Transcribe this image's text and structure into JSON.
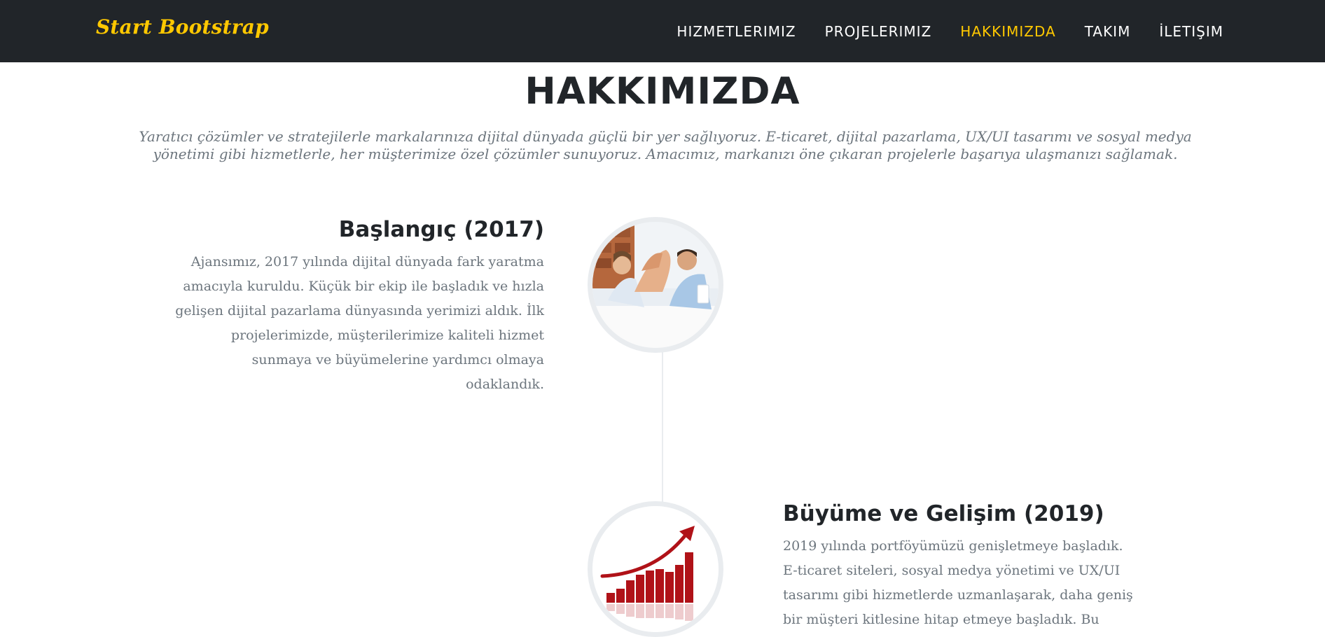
{
  "navbar": {
    "brand": "Start Bootstrap",
    "links": [
      {
        "label": "HIZMETLERIMIZ",
        "active": false
      },
      {
        "label": "PROJELERIMIZ",
        "active": false
      },
      {
        "label": "HAKKIMIZDA",
        "active": true
      },
      {
        "label": "TAKIM",
        "active": false
      },
      {
        "label": "İLETIŞIM",
        "active": false
      }
    ]
  },
  "section": {
    "heading": "HAKKIMIZDA",
    "subheading": "Yaratıcı çözümler ve stratejilerle markalarınıza dijital dünyada güçlü bir yer sağlıyoruz. E-ticaret, dijital pazarlama, UX/UI tasarımı ve sosyal medya yönetimi gibi hizmetlerle, her müşterimize özel çözümler sunuyoruz. Amacımız, markanızı öne çıkaran projelerle başarıya ulaşmanızı sağlamak."
  },
  "timeline": [
    {
      "title": "Başlangıç (2017)",
      "body": "Ajansımız, 2017 yılında dijital dünyada fark yaratma amacıyla kuruldu. Küçük bir ekip ile başladık ve hızla gelişen dijital pazarlama dünyasında yerimizi aldık. İlk projelerimizde, müşterilerimize kaliteli hizmet sunmaya ve büyümelerine yardımcı olmaya odaklandık.",
      "image_icon": "team-high-five-photo"
    },
    {
      "title": "Büyüme ve Gelişim (2019)",
      "body": "2019 yılında portföyümüzü genişletmeye başladık. E-ticaret siteleri, sosyal medya yönetimi ve UX/UI tasarımı gibi hizmetlerde uzmanlaşarak, daha geniş bir müşteri kitlesine hitap etmeye başladık. Bu",
      "image_icon": "growth-bar-chart-image"
    }
  ],
  "colors": {
    "navbar_bg": "#212529",
    "accent": "#ffc800",
    "heading": "#212529",
    "muted": "#6c757d",
    "timeline_border": "#e9ecef"
  }
}
